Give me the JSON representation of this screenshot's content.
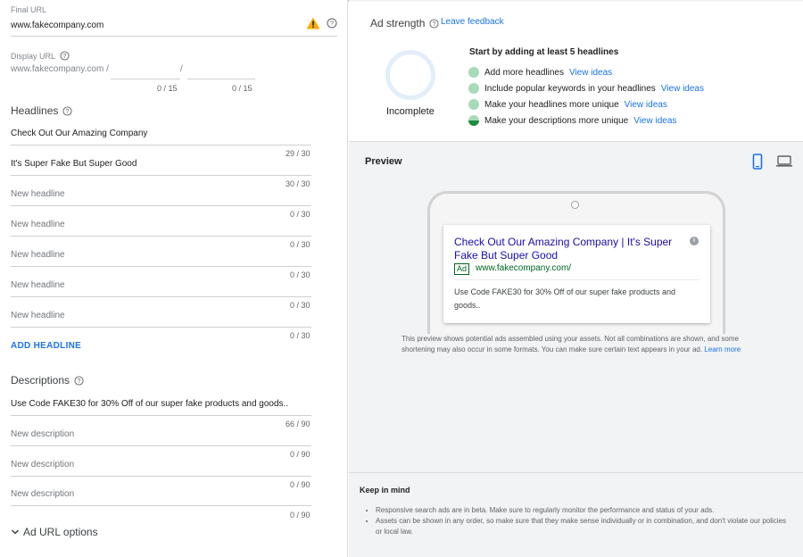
{
  "final_url": {
    "label": "Final URL",
    "value": "www.fakecompany.com"
  },
  "display_url": {
    "label": "Display URL",
    "base": "www.fakecompany.com /",
    "separator": "/",
    "path1_count": "0 / 15",
    "path2_count": "0 / 15"
  },
  "headlines": {
    "title": "Headlines",
    "items": [
      {
        "value": "Check Out Our Amazing Company",
        "placeholder": "",
        "count": "29 / 30"
      },
      {
        "value": "It's Super Fake But Super Good",
        "placeholder": "",
        "count": "30 / 30"
      },
      {
        "value": "",
        "placeholder": "New headline",
        "count": "0 / 30"
      },
      {
        "value": "",
        "placeholder": "New headline",
        "count": "0 / 30"
      },
      {
        "value": "",
        "placeholder": "New headline",
        "count": "0 / 30"
      },
      {
        "value": "",
        "placeholder": "New headline",
        "count": "0 / 30"
      },
      {
        "value": "",
        "placeholder": "New headline",
        "count": "0 / 30"
      }
    ],
    "add_label": "ADD HEADLINE"
  },
  "descriptions": {
    "title": "Descriptions",
    "items": [
      {
        "value": "Use Code FAKE30 for 30% Off of our super fake products and goods..",
        "placeholder": "",
        "count": "66 / 90"
      },
      {
        "value": "",
        "placeholder": "New description",
        "count": "0 / 90"
      },
      {
        "value": "",
        "placeholder": "New description",
        "count": "0 / 90"
      },
      {
        "value": "",
        "placeholder": "New description",
        "count": "0 / 90"
      }
    ]
  },
  "ad_url_options": "Ad URL options",
  "ad_strength": {
    "title": "Ad strength",
    "feedback_link": "Leave feedback",
    "status": "Incomplete",
    "tips_title": "Start by adding at least 5 headlines",
    "tips": [
      {
        "text": "Add more headlines",
        "link": "View ideas"
      },
      {
        "text": "Include popular keywords in your headlines",
        "link": "View ideas"
      },
      {
        "text": "Make your headlines more unique",
        "link": "View ideas"
      },
      {
        "text": "Make your descriptions more unique",
        "link": "View ideas"
      }
    ]
  },
  "preview": {
    "title": "Preview",
    "ad": {
      "headline": "Check Out Our Amazing Company | It's Super Fake But Super Good",
      "badge": "Ad",
      "url": "www.fakecompany.com/",
      "description": "Use Code FAKE30 for 30% Off of our super fake products and goods..",
      "info_glyph": "i"
    },
    "note": "This preview shows potential ads assembled using your assets. Not all combinations are shown, and some shortening may also occur in some formats. You can make sure certain text appears in your ad.",
    "learn_more": "Learn more"
  },
  "keep_in_mind": {
    "title": "Keep in mind",
    "items": [
      "Responsive search ads are in beta. Make sure to regularly monitor the performance and status of your ads.",
      "Assets can be shown in any order, so make sure that they make sense individually or in combination, and don't violate our policies or local law."
    ]
  },
  "colors": {
    "link": "#1a73e8",
    "ad_headline": "#1a0dab",
    "ad_url": "#006621",
    "warning": "#f9ab00",
    "tip_dot": "#a8dab5",
    "tip_dot_dark": "#1e8e3e"
  },
  "icons": {
    "warning": "warning-icon",
    "help": "help-circle-icon",
    "mobile": "mobile-phone-icon",
    "desktop": "laptop-icon",
    "chevron": "chevron-down-icon"
  }
}
